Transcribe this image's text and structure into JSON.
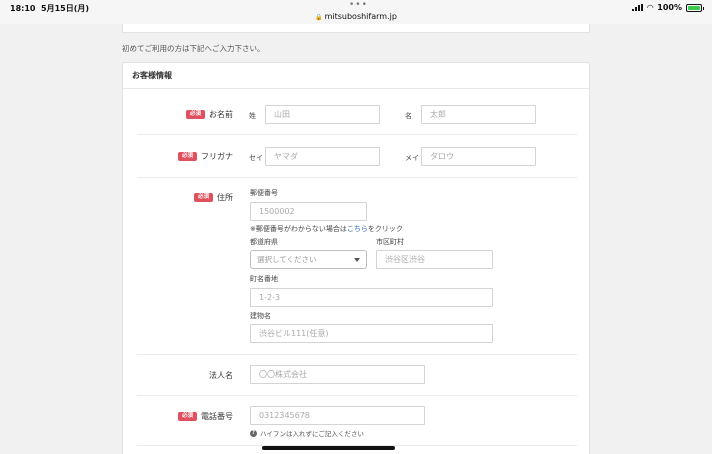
{
  "status_bar": {
    "time": "18:10",
    "date": "5月15日(月)",
    "url": "mitsuboshifarm.jp",
    "battery": "100%",
    "battery_level": 1.0
  },
  "intro_text": "初めてご利用の方は下記へご入力下さい。",
  "section_title": "お客様情報",
  "required_badge": "必須",
  "name": {
    "label": "お名前",
    "last_label": "姓",
    "last_placeholder": "山田",
    "first_label": "名",
    "first_placeholder": "太郎"
  },
  "furigana": {
    "label": "フリガナ",
    "last_label": "セイ",
    "last_placeholder": "ヤマダ",
    "first_label": "メイ",
    "first_placeholder": "タロウ"
  },
  "address": {
    "label": "住所",
    "postal_label": "郵便番号",
    "postal_placeholder": "1500002",
    "postal_hint_prefix": "※郵便番号がわからない場合は",
    "postal_hint_link": "こちら",
    "postal_hint_suffix": "をクリック",
    "prefecture_label": "都道府県",
    "prefecture_selected": "選択してください",
    "city_label": "市区町村",
    "city_placeholder": "渋谷区渋谷",
    "street_label": "町名番地",
    "street_placeholder": "1-2-3",
    "building_label": "建物名",
    "building_placeholder": "渋谷ビル111(任意)"
  },
  "company": {
    "label": "法人名",
    "placeholder": "〇〇株式会社"
  },
  "phone": {
    "label": "電話番号",
    "placeholder": "0312345678",
    "note": "ハイフンは入れずにご記入ください"
  },
  "icons": {
    "lock": "lock-icon",
    "signal": "signal-icon",
    "wifi": "wifi-icon",
    "battery": "battery-icon",
    "dropdown": "chevron-down-icon",
    "help": "question-circle-icon"
  },
  "colors": {
    "required_badge": "#e0505e",
    "link": "#2f6db5",
    "battery_fill": "#3cc84a"
  }
}
